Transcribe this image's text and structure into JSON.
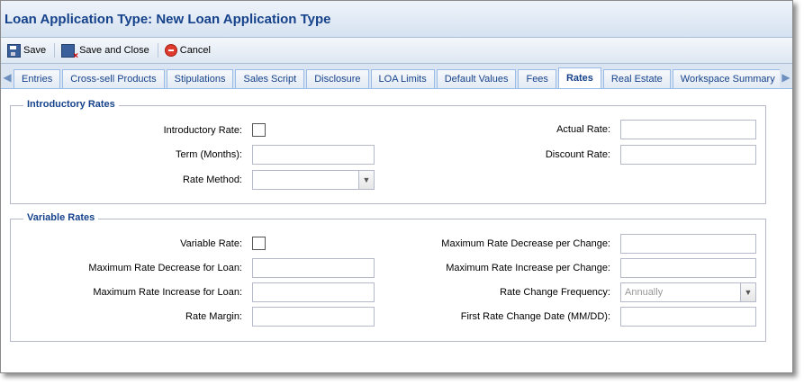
{
  "window": {
    "title": "Loan Application Type: New Loan Application Type"
  },
  "toolbar": {
    "save": "Save",
    "save_close": "Save and Close",
    "cancel": "Cancel"
  },
  "tabs": {
    "items": [
      "Entries",
      "Cross-sell Products",
      "Stipulations",
      "Sales Script",
      "Disclosure",
      "LOA Limits",
      "Default Values",
      "Fees",
      "Rates",
      "Real Estate",
      "Workspace Summary"
    ],
    "active": "Rates"
  },
  "intro": {
    "legend": "Introductory Rates",
    "introductory_rate_label": "Introductory Rate:",
    "term_label": "Term (Months):",
    "rate_method_label": "Rate Method:",
    "actual_rate_label": "Actual Rate:",
    "discount_rate_label": "Discount Rate:"
  },
  "variable": {
    "legend": "Variable Rates",
    "variable_rate_label": "Variable Rate:",
    "max_dec_loan_label": "Maximum Rate Decrease for Loan:",
    "max_inc_loan_label": "Maximum Rate Increase for Loan:",
    "rate_margin_label": "Rate Margin:",
    "max_dec_change_label": "Maximum Rate Decrease per Change:",
    "max_inc_change_label": "Maximum Rate Increase per Change:",
    "freq_label": "Rate Change Frequency:",
    "freq_value": "Annually",
    "first_date_label": "First Rate Change Date (MM/DD):"
  }
}
